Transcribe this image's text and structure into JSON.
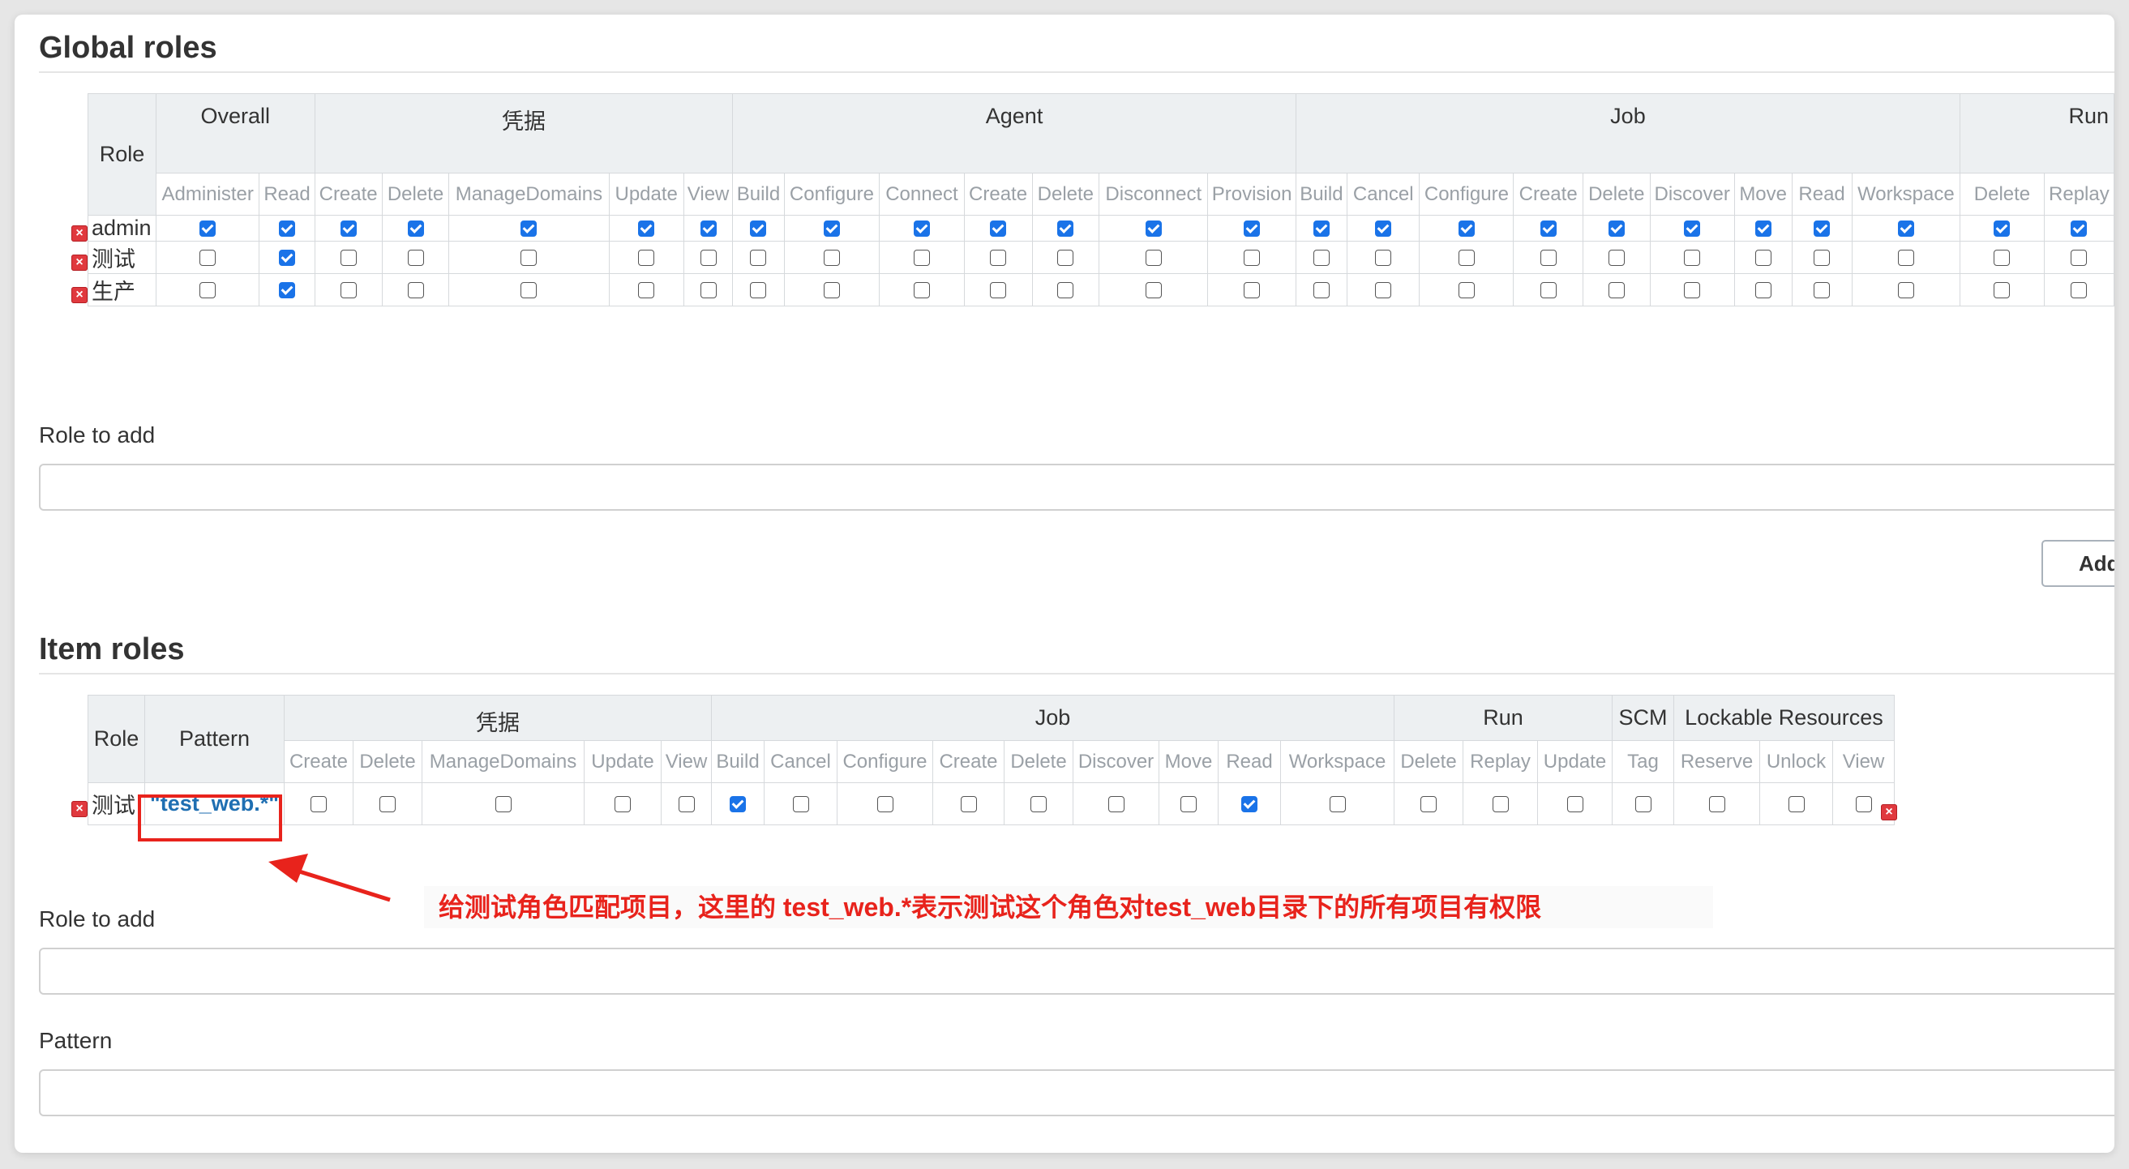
{
  "global_roles": {
    "title": "Global roles",
    "role_header": "Role",
    "groups": [
      {
        "label": "Overall",
        "perms": [
          "Administer",
          "Read"
        ]
      },
      {
        "label": "凭据",
        "perms": [
          "Create",
          "Delete",
          "ManageDomains",
          "Update",
          "View"
        ]
      },
      {
        "label": "Agent",
        "perms": [
          "Build",
          "Configure",
          "Connect",
          "Create",
          "Delete",
          "Disconnect",
          "Provision"
        ]
      },
      {
        "label": "Job",
        "perms": [
          "Build",
          "Cancel",
          "Configure",
          "Create",
          "Delete",
          "Discover",
          "Move",
          "Read",
          "Workspace"
        ]
      },
      {
        "label": "Run",
        "perms": [
          "Delete",
          "Replay"
        ]
      }
    ],
    "rows": [
      {
        "name": "admin",
        "checks": [
          1,
          1,
          1,
          1,
          1,
          1,
          1,
          1,
          1,
          1,
          1,
          1,
          1,
          1,
          1,
          1,
          1,
          1,
          1,
          1,
          1,
          1,
          1,
          1,
          1
        ]
      },
      {
        "name": "测试",
        "checks": [
          0,
          1,
          0,
          0,
          0,
          0,
          0,
          0,
          0,
          0,
          0,
          0,
          0,
          0,
          0,
          0,
          0,
          0,
          0,
          0,
          0,
          0,
          0,
          0,
          0
        ]
      },
      {
        "name": "生产",
        "checks": [
          0,
          1,
          0,
          0,
          0,
          0,
          0,
          0,
          0,
          0,
          0,
          0,
          0,
          0,
          0,
          0,
          0,
          0,
          0,
          0,
          0,
          0,
          0,
          0,
          0
        ]
      }
    ],
    "role_to_add_label": "Role to add",
    "add_button": "Add"
  },
  "item_roles": {
    "title": "Item roles",
    "role_header": "Role",
    "pattern_header": "Pattern",
    "groups": [
      {
        "label": "凭据",
        "perms": [
          "Create",
          "Delete",
          "ManageDomains",
          "Update",
          "View"
        ]
      },
      {
        "label": "Job",
        "perms": [
          "Build",
          "Cancel",
          "Configure",
          "Create",
          "Delete",
          "Discover",
          "Move",
          "Read",
          "Workspace"
        ]
      },
      {
        "label": "Run",
        "perms": [
          "Delete",
          "Replay",
          "Update"
        ]
      },
      {
        "label": "SCM",
        "perms": [
          "Tag"
        ]
      },
      {
        "label": "Lockable Resources",
        "perms": [
          "Reserve",
          "Unlock",
          "View"
        ]
      }
    ],
    "rows": [
      {
        "name": "测试",
        "pattern": "\"test_web.*\"",
        "checks": [
          0,
          0,
          0,
          0,
          0,
          1,
          0,
          0,
          0,
          0,
          0,
          0,
          1,
          0,
          0,
          0,
          0,
          0,
          0,
          0,
          0
        ]
      }
    ],
    "role_to_add_label": "Role to add",
    "pattern_label": "Pattern"
  },
  "annotation": {
    "text": "给测试角色匹配项目，这里的 test_web.*表示测试这个角色对test_web目录下的所有项目有权限",
    "color": "#e8231c"
  },
  "colors": {
    "checkbox_checked": "#1a73e8",
    "header_bg": "#edf0f2",
    "delete_icon": "#e0393e",
    "pattern_text": "#1f6fb2"
  },
  "icons": {
    "delete": "delete-icon",
    "arrow": "arrow-icon"
  }
}
